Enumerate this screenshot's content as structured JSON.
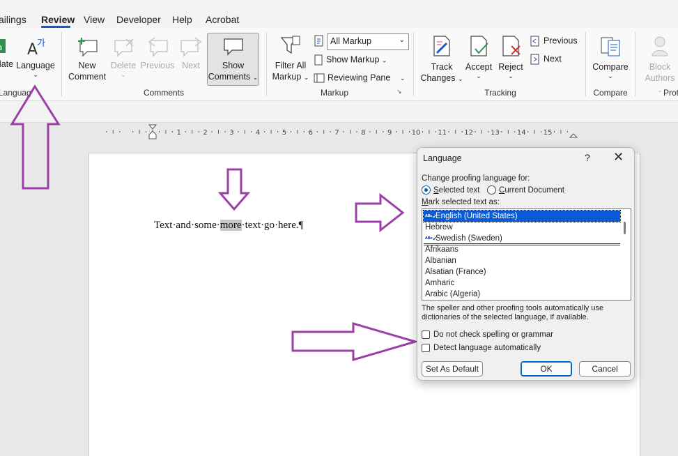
{
  "tabs": [
    {
      "label": "ailings"
    },
    {
      "label": "Review",
      "active": true
    },
    {
      "label": "View"
    },
    {
      "label": "Developer"
    },
    {
      "label": "Help"
    },
    {
      "label": "Acrobat"
    }
  ],
  "ribbon": {
    "translate_label": "late",
    "language_label": "Language",
    "language_group": "Languag",
    "new_comment": [
      "New",
      "Comment"
    ],
    "delete": "Delete",
    "previous": "Previous",
    "next": "Next",
    "show_comments": [
      "Show",
      "Comments"
    ],
    "comments_group": "Comments",
    "filter_all_markup": [
      "Filter All",
      "Markup"
    ],
    "markup_dropdown_value": "All Markup",
    "show_markup": "Show Markup",
    "reviewing_pane": "Reviewing Pane",
    "markup_group": "Markup",
    "track_changes": [
      "Track",
      "Changes"
    ],
    "accept": "Accept",
    "reject": "Reject",
    "tracking_previous": "Previous",
    "tracking_next": "Next",
    "tracking_group": "Tracking",
    "compare": "Compare",
    "compare_group": "Compare",
    "block_authors": [
      "Block",
      "Authors"
    ],
    "protect_group": "Prot"
  },
  "ruler": {
    "numbers": [
      "1",
      "2",
      "3",
      "4",
      "5",
      "6",
      "7",
      "8",
      "9",
      "10",
      "11",
      "12",
      "13",
      "14",
      "15"
    ]
  },
  "document": {
    "text_before": "Text·and·some·",
    "text_highlight": "more",
    "text_after": "·text·go·here.¶"
  },
  "dialog": {
    "title": "Language",
    "help": "?",
    "close": "✕",
    "change_for_label": "Change proofing language for:",
    "radio_selected_text": "Selected text",
    "radio_current_document": "Current Document",
    "mark_label": "Mark selected text as:",
    "top_languages": [
      {
        "name": "English (United States)",
        "proof": true,
        "selected": true
      },
      {
        "name": "Hebrew",
        "proof": false
      },
      {
        "name": "Swedish (Sweden)",
        "proof": true
      }
    ],
    "languages": [
      "Afrikaans",
      "Albanian",
      "Alsatian (France)",
      "Amharic",
      "Arabic (Algeria)"
    ],
    "description": "The speller and other proofing tools automatically use dictionaries of the selected language, if available.",
    "check_no_spelling": "Do not check spelling or grammar",
    "check_detect": "Detect language automatically",
    "btn_default": "Set As Default",
    "btn_ok": "OK",
    "btn_cancel": "Cancel"
  },
  "colors": {
    "accent": "#185abd",
    "annotation_arrow": "#9b3fa6",
    "selection": "#0a5cd6"
  }
}
